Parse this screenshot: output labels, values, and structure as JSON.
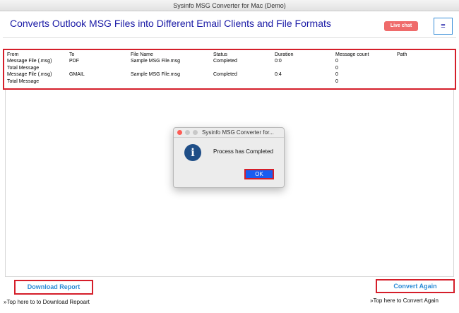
{
  "window": {
    "title": "Sysinfo MSG Converter for Mac (Demo)"
  },
  "header": {
    "headline": "Converts Outlook MSG Files into Different Email Clients and File Formats",
    "live_chat_label": "Live chat",
    "menu_glyph": "≡"
  },
  "table": {
    "columns": [
      "From",
      "To",
      "File Name",
      "Status",
      "Duration",
      "Message count",
      "Path"
    ],
    "rows": [
      [
        "Message File (.msg)",
        "PDF",
        "Sample MSG File.msg",
        "Completed",
        "0:0",
        "0",
        ""
      ],
      [
        "Total Message",
        "",
        "",
        "",
        "",
        "0",
        ""
      ],
      [
        "Message File (.msg)",
        "GMAIL",
        "Sample MSG File.msg",
        "Completed",
        "0:4",
        "0",
        ""
      ],
      [
        "Total Message",
        "",
        "",
        "",
        "",
        "0",
        ""
      ]
    ]
  },
  "dialog": {
    "title": "Sysinfo MSG Converter for...",
    "message": "Process has Completed",
    "icon": "i",
    "ok_label": "OK"
  },
  "footer": {
    "download_label": "Download Report",
    "download_hint": "»Top here to to Download Repoart",
    "convert_label": "Convert Again",
    "convert_hint": "»Top here to Convert Again"
  },
  "colors": {
    "headline": "#1a1aa6",
    "highlight_border": "#d51e2a",
    "button_text": "#2c8bd6",
    "live_chat": "#ef6b6b",
    "ok_button": "#1a5cf0"
  }
}
